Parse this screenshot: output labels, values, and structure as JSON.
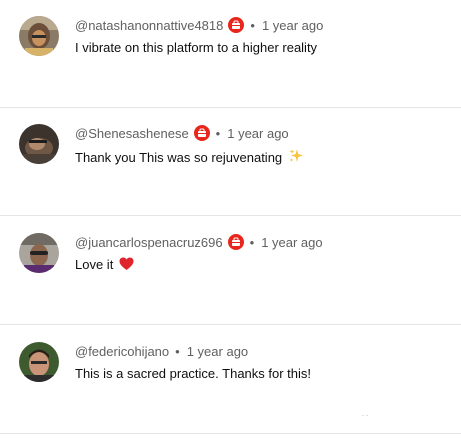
{
  "comments": [
    {
      "handle": "@natashanonnattive4818",
      "member_badge": true,
      "separator": "•",
      "time": "1 year ago",
      "text": "I vibrate on this platform to a higher reality",
      "avatar_icon": "avatar-natasha"
    },
    {
      "handle": "@Shenesashenese",
      "member_badge": true,
      "separator": "•",
      "time": "1 year ago",
      "text": "Thank you This was so rejuvenating",
      "emoji": "sparkles-icon",
      "avatar_icon": "avatar-shenesa"
    },
    {
      "handle": "@juancarlospenacruz696",
      "member_badge": true,
      "separator": "•",
      "time": "1 year ago",
      "text": "Love it",
      "emoji": "red-heart-icon",
      "avatar_icon": "avatar-juancarlos"
    },
    {
      "handle": "@federicohijano",
      "member_badge": false,
      "separator": "•",
      "time": "1 year ago",
      "text": "This is a sacred practice. Thanks for this!",
      "avatar_icon": "avatar-federico"
    }
  ],
  "colors": {
    "badge": "#e8261c",
    "muted": "#606060",
    "divider": "#e5e5e5",
    "text": "#0f0f0f"
  }
}
